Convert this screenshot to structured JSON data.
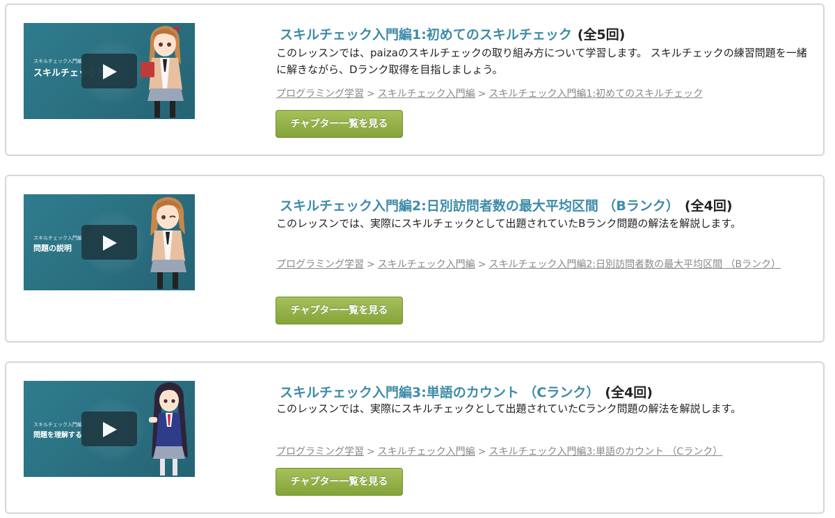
{
  "cards": [
    {
      "title": "スキルチェック入門編1:初めてのスキルチェック",
      "count": "(全5回)",
      "description": "このレッスンでは、paizaのスキルチェックの取り組み方について学習します。 スキルチェックの練習問題を一緒に解きながら、Dランク取得を目指しましょう。",
      "thumb_small": "スキルチェック入門編",
      "thumb_caption": "スキルチェックと",
      "breadcrumbs": [
        "プログラミング学習",
        "スキルチェック入門編",
        "スキルチェック入門編1:初めてのスキルチェック"
      ],
      "button_label": "チャプター一覧を見る"
    },
    {
      "title": "スキルチェック入門編2:日別訪問者数の最大平均区間 （Bランク）",
      "count": "(全4回)",
      "description": "このレッスンでは、実際にスキルチェックとして出題されていたBランク問題の解法を解説します。",
      "thumb_small": "スキルチェック入門編",
      "thumb_caption": "問題の説明",
      "breadcrumbs": [
        "プログラミング学習",
        "スキルチェック入門編",
        "スキルチェック入門編2:日別訪問者数の最大平均区間 （Bランク）"
      ],
      "button_label": "チャプター一覧を見る"
    },
    {
      "title": "スキルチェック入門編3:単語のカウント （Cランク）",
      "count": "(全4回)",
      "description": "このレッスンでは、実際にスキルチェックとして出題されていたCランク問題の解法を解説します。",
      "thumb_small": "スキルチェック入門編",
      "thumb_caption": "問題を理解する",
      "breadcrumbs": [
        "プログラミング学習",
        "スキルチェック入門編",
        "スキルチェック入門編3:単語のカウント （Cランク）"
      ],
      "button_label": "チャプター一覧を見る"
    }
  ],
  "breadcrumb_separator": ">",
  "colors": {
    "title": "#3d8ba8",
    "button": "#93b049",
    "thumb_bg": "#2a6f80"
  }
}
